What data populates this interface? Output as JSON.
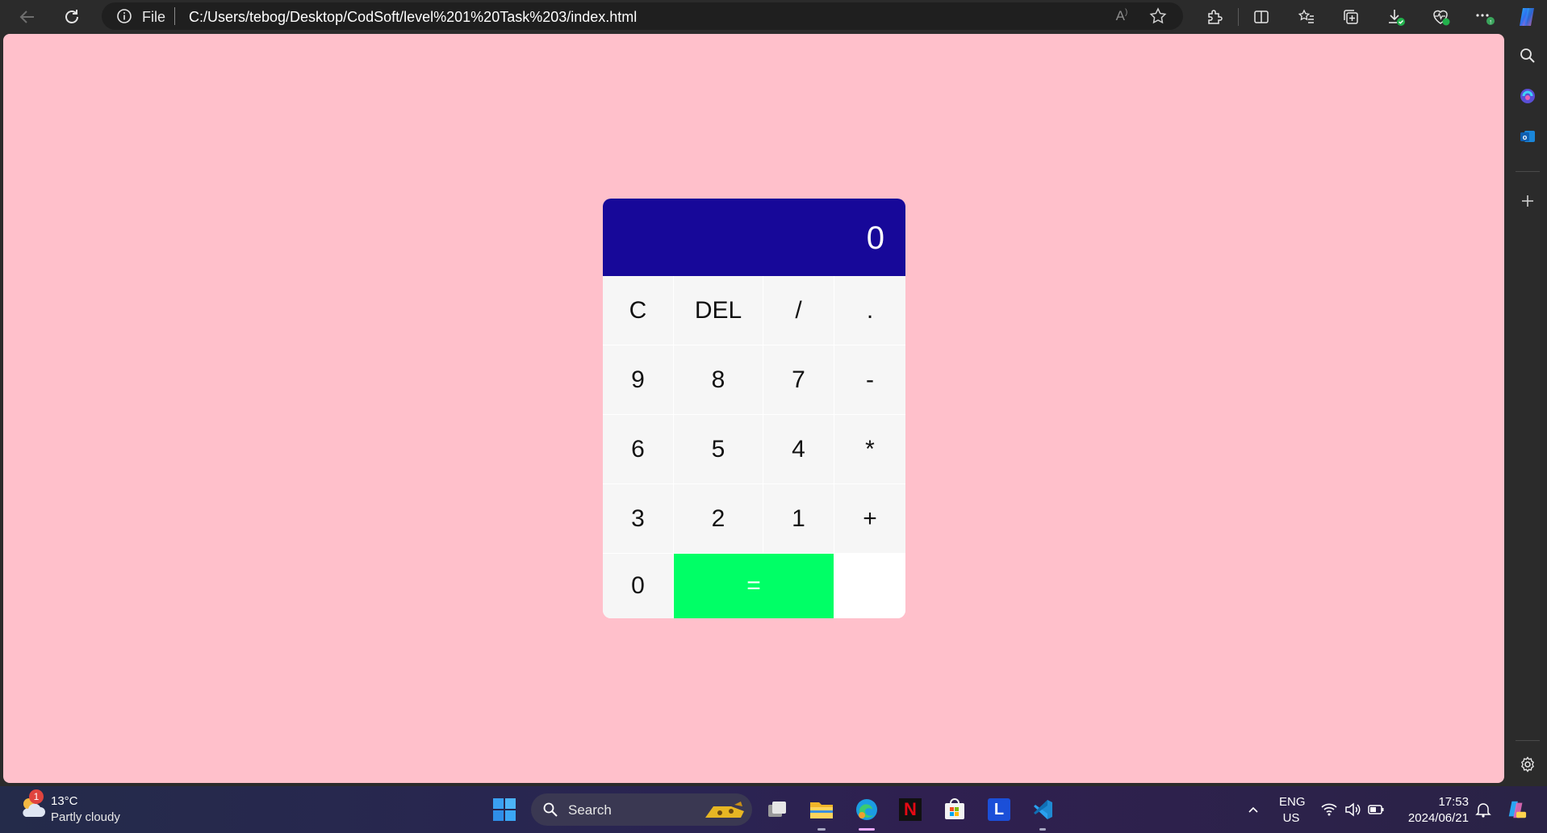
{
  "browser": {
    "address_prefix": "File",
    "url": "C:/Users/tebog/Desktop/CodSoft/level%201%20Task%203/index.html",
    "read_aloud_glyph": "A",
    "sidebar_icons": [
      "search-icon",
      "copilot-icon",
      "outlook-icon",
      "add-icon",
      "settings-icon"
    ]
  },
  "page": {
    "background_color": "#ffc0cb"
  },
  "calculator": {
    "display_value": "0",
    "display_color": "#170899",
    "equals_color": "#00ff66",
    "keys": {
      "clear": "C",
      "delete": "DEL",
      "divide": "/",
      "decimal": ".",
      "nine": "9",
      "eight": "8",
      "seven": "7",
      "minus": "-",
      "six": "6",
      "five": "5",
      "four": "4",
      "multiply": "*",
      "three": "3",
      "two": "2",
      "one": "1",
      "plus": "+",
      "zero": "0",
      "equals": "="
    }
  },
  "taskbar": {
    "weather": {
      "temperature": "13°C",
      "description": "Partly cloudy",
      "badge": "1"
    },
    "search_label": "Search",
    "apps": [
      "windows-start-icon",
      "task-view-icon",
      "file-explorer-icon",
      "edge-icon",
      "netflix-icon",
      "microsoft-store-icon",
      "l-app-icon",
      "vscode-icon"
    ],
    "netflix_glyph": "N",
    "l_app_glyph": "L",
    "language_primary": "ENG",
    "language_secondary": "US",
    "time": "17:53",
    "date": "2024/06/21"
  }
}
